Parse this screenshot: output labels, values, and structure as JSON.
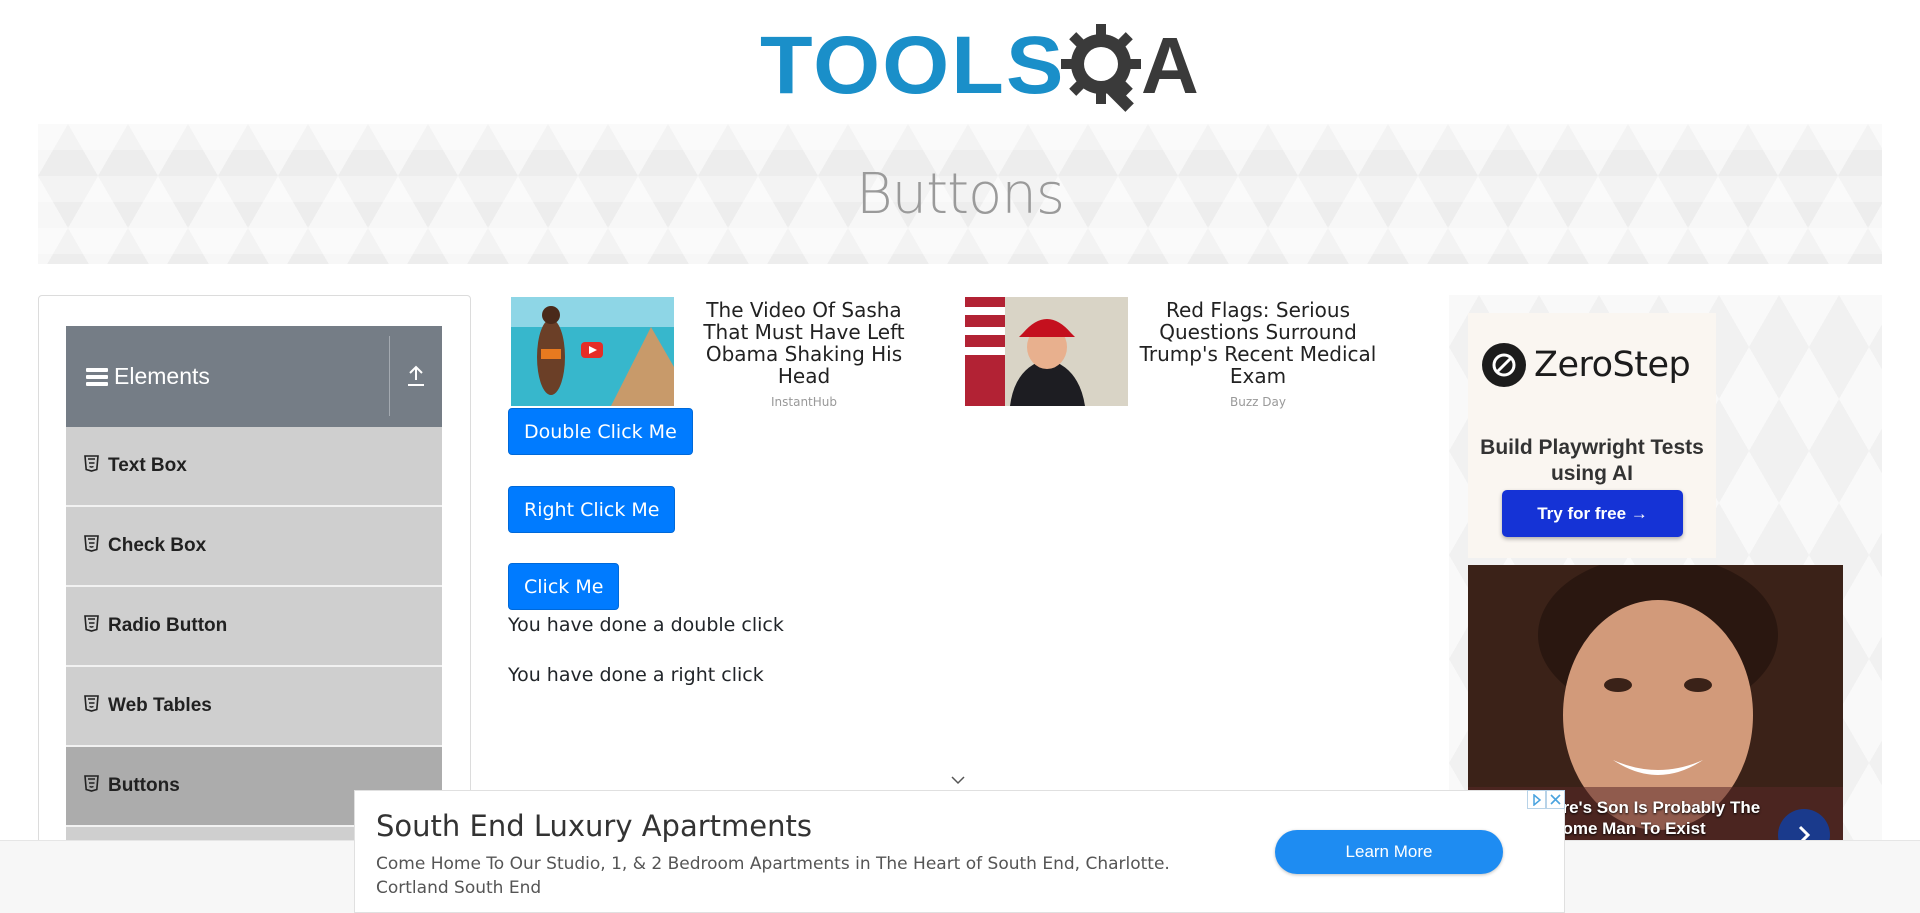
{
  "logo": {
    "text": "TOOLS",
    "suffix": "A",
    "colors": {
      "tools": "#1a8fc9",
      "gear": "#3a3a3a"
    }
  },
  "banner": {
    "title": "Buttons"
  },
  "sidebar": {
    "group": {
      "label": "Elements",
      "icon": "menu-icon",
      "collapse_icon": "upload-arrow-icon"
    },
    "items": [
      {
        "label": "Text Box",
        "icon": "html5-icon",
        "active": false
      },
      {
        "label": "Check Box",
        "icon": "html5-icon",
        "active": false
      },
      {
        "label": "Radio Button",
        "icon": "html5-icon",
        "active": false
      },
      {
        "label": "Web Tables",
        "icon": "html5-icon",
        "active": false
      },
      {
        "label": "Buttons",
        "icon": "html5-icon",
        "active": true
      }
    ]
  },
  "sponsored": [
    {
      "title": "The Video Of Sasha That Must Have Left Obama Shaking His Head",
      "source": "InstantHub"
    },
    {
      "title": "Red Flags: Serious Questions Surround Trump's Recent Medical Exam",
      "source": "Buzz Day"
    }
  ],
  "buttons": {
    "double_click": "Double Click Me",
    "right_click": "Right Click Me",
    "click": "Click Me"
  },
  "messages": {
    "double_click": "You have done a double click",
    "right_click": "You have done a right click"
  },
  "right_ad": {
    "brand": "ZeroStep",
    "subtitle": "Build Playwright Tests using AI",
    "cta": "Try for free →",
    "caption": "ere's Son Is Probably The\nsome Man To Exist"
  },
  "bottom_ad": {
    "title": "South End Luxury Apartments",
    "body": "Come Home To Our Studio, 1, & 2 Bedroom Apartments in The Heart of South End, Charlotte. Cortland South End",
    "cta": "Learn More"
  },
  "colors": {
    "primary": "#007bff",
    "sidebar_header": "#757d86",
    "menu_item": "#cfcfcf",
    "menu_item_active": "#acacac"
  }
}
